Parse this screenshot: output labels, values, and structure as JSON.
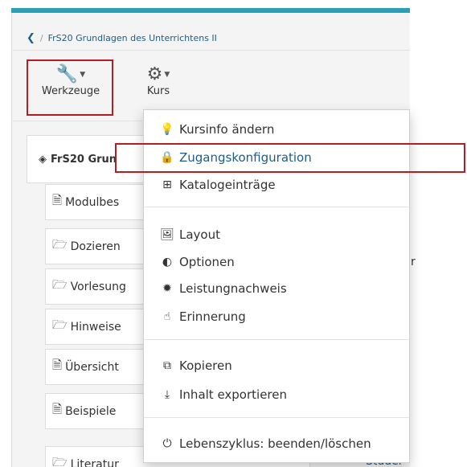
{
  "breadcrumb": {
    "back_icon": "chevron-left-icon",
    "separator": "/",
    "course_title": "FrS20 Grundlagen des Unterrichtens II"
  },
  "toolbar": {
    "tools_label": "Werkzeuge",
    "tools_icon": "wrench-icon",
    "course_label": "Kurs",
    "course_icon": "gears-icon"
  },
  "tree": {
    "root_label": "FrS20 Grun",
    "items": [
      {
        "label": "Modulbes",
        "icon": "file-icon"
      },
      {
        "label": "Dozieren",
        "icon": "folder-icon"
      },
      {
        "label": "Vorlesung",
        "icon": "folder-icon"
      },
      {
        "label": "Hinweise",
        "icon": "folder-icon"
      },
      {
        "label": "Übersicht",
        "icon": "file-icon"
      },
      {
        "label": "Beispiele",
        "icon": "file-icon"
      },
      {
        "label": "Literatur",
        "icon": "folder-icon"
      }
    ]
  },
  "menu": {
    "items": [
      {
        "label": "Kursinfo ändern",
        "icon": "lightbulb-icon"
      },
      {
        "label": "Zugangskonfiguration",
        "icon": "lock-icon"
      },
      {
        "label": "Katalogeinträge",
        "icon": "sitemap-icon"
      },
      {
        "label": "Layout",
        "icon": "image-icon"
      },
      {
        "label": "Optionen",
        "icon": "toggle-icon"
      },
      {
        "label": "Leistungnachweis",
        "icon": "badge-icon"
      },
      {
        "label": "Erinnerung",
        "icon": "hand-pointer-icon"
      },
      {
        "label": "Kopieren",
        "icon": "copy-icon"
      },
      {
        "label": "Inhalt exportieren",
        "icon": "download-icon"
      },
      {
        "label": "Lebenszyklus: beenden/löschen",
        "icon": "power-icon"
      }
    ]
  },
  "right_fragments": {
    "r1": "r",
    "r2": "Studer"
  },
  "colors": {
    "accent": "#2a9fb5",
    "link": "#1d5d88",
    "highlight": "#b21e24"
  }
}
